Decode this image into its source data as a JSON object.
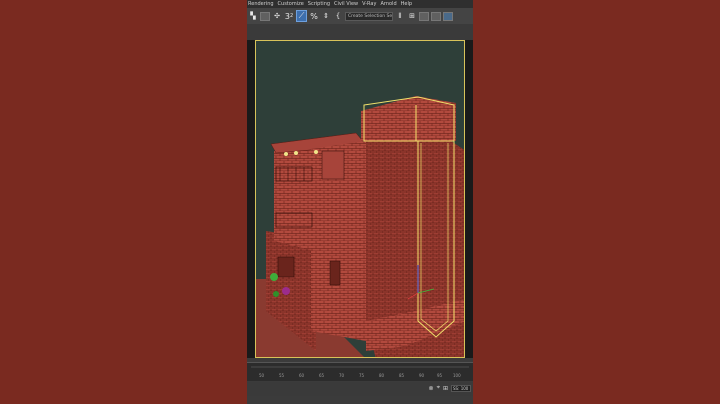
{
  "menu": [
    "Rendering",
    "Customize",
    "Scripting",
    "Civil View",
    "V-Ray",
    "Arnold",
    "Help"
  ],
  "toolbar": {
    "snap_label": "3",
    "snap_superscript": "2",
    "percent_snap": "%",
    "curly_brace": "{",
    "selection_set_placeholder": "Create Selection Se"
  },
  "timeline": {
    "tick_labels": [
      "50",
      "55",
      "60",
      "65",
      "70",
      "75",
      "80",
      "85",
      "90",
      "95",
      "100"
    ]
  },
  "status": {
    "zoom_field": "SS: 100"
  },
  "colors": {
    "page_bg": "#7a2a20",
    "viewport_bg": "#2e3f39",
    "building_fill": "#b24a3e",
    "building_line": "#5a1a12",
    "selection_outline": "#f1e06b"
  }
}
